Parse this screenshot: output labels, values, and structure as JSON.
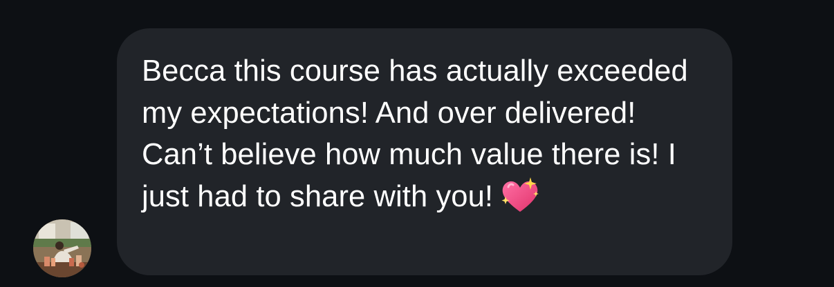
{
  "conversation": {
    "message": {
      "text": "Becca this course has actually exceeded my expectations! And over delivered! Can’t believe how much value there is! I just had to share with you!",
      "emoji": "sparkling-heart-icon"
    },
    "sender": {
      "avatar": "profile-photo"
    }
  },
  "colors": {
    "background": "#0d1014",
    "bubble": "#212429",
    "text": "#ffffff",
    "heart": "#f0457f"
  }
}
